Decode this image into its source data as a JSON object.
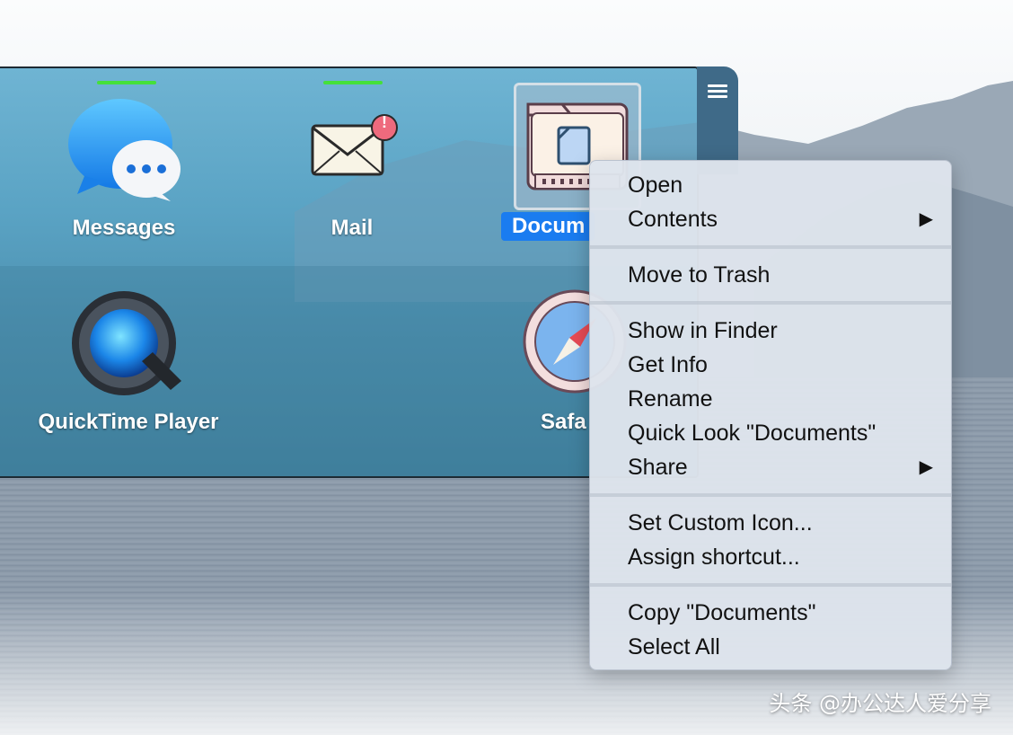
{
  "launcher": {
    "apps": [
      {
        "name": "Messages",
        "running": true
      },
      {
        "name": "Mail",
        "running": true
      },
      {
        "name": "Documents",
        "running": false,
        "selected": true,
        "label_visible": "Docum"
      },
      {
        "name": "QuickTime Player",
        "running": false
      },
      {
        "name": "Safari",
        "running": false,
        "label_visible": "Safa"
      }
    ],
    "mail_badge": "!",
    "menu_icon": "hamburger-menu-icon"
  },
  "context_menu": {
    "groups": [
      [
        {
          "label": "Open"
        },
        {
          "label": "Contents",
          "submenu": true
        }
      ],
      [
        {
          "label": "Move to Trash"
        }
      ],
      [
        {
          "label": "Show in Finder"
        },
        {
          "label": "Get Info"
        },
        {
          "label": "Rename"
        },
        {
          "label": "Quick Look \"Documents\""
        },
        {
          "label": "Share",
          "submenu": true
        }
      ],
      [
        {
          "label": "Set Custom Icon..."
        },
        {
          "label": "Assign shortcut..."
        }
      ],
      [
        {
          "label": "Copy \"Documents\""
        },
        {
          "label": "Select All"
        }
      ]
    ],
    "submenu_arrow": "▶"
  },
  "watermark": "头条 @办公达人爱分享",
  "colors": {
    "selection": "#1a7cf0",
    "running_indicator": "#45e03a"
  }
}
